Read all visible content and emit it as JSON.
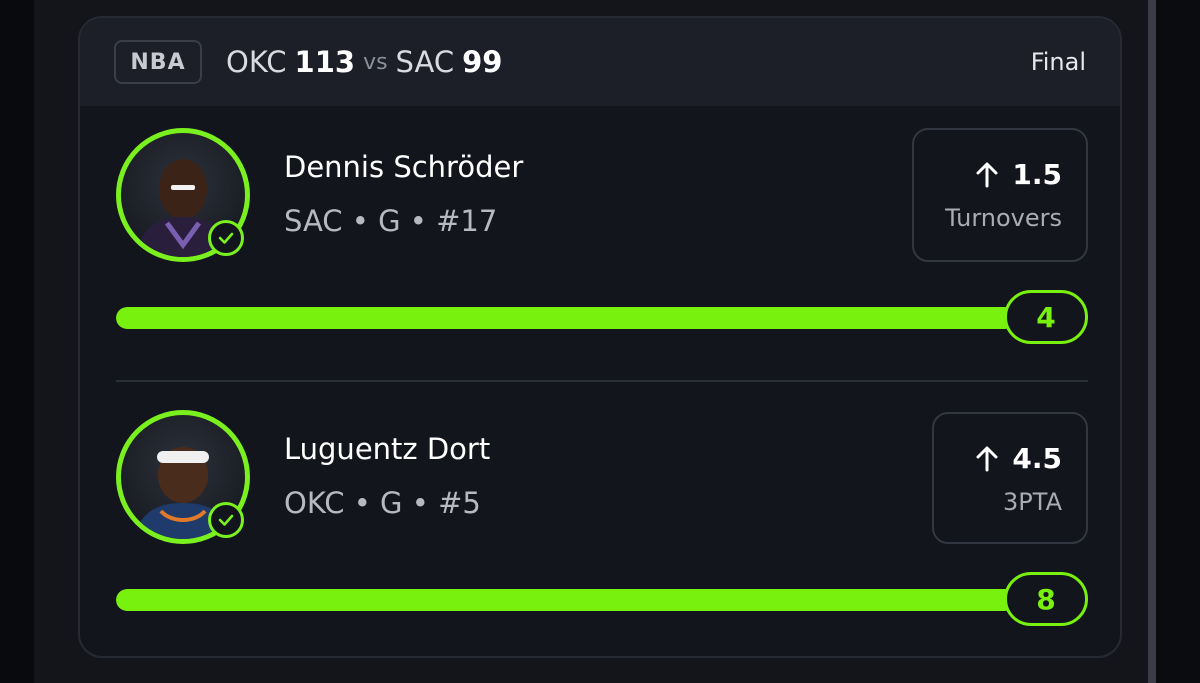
{
  "game": {
    "league": "NBA",
    "team_a": "OKC",
    "score_a": "113",
    "vs": "vs",
    "team_b": "SAC",
    "score_b": "99",
    "status": "Final"
  },
  "players": [
    {
      "name": "Dennis Schröder",
      "meta": "SAC • G • #17",
      "line": "1.5",
      "direction_icon": "arrow-up-icon",
      "stat": "Turnovers",
      "result": "4",
      "progress_fraction": 1.0
    },
    {
      "name": "Luguentz Dort",
      "meta": "OKC • G • #5",
      "line": "4.5",
      "direction_icon": "arrow-up-icon",
      "stat": "3PTA",
      "result": "8",
      "progress_fraction": 1.0
    }
  ],
  "colors": {
    "accent": "#78f10f",
    "card_bg": "#13151c",
    "header_bg": "#1c1f27"
  }
}
